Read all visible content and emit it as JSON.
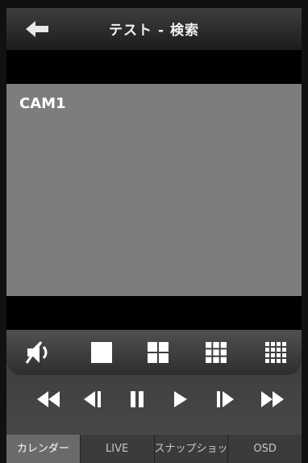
{
  "header": {
    "title": "テスト - 検索"
  },
  "video": {
    "camera_label": "CAM1"
  },
  "layout_buttons": [
    {
      "icon": "mute-speaker-icon"
    },
    {
      "icon": "layout-1-icon"
    },
    {
      "icon": "layout-4-icon"
    },
    {
      "icon": "layout-9-icon"
    },
    {
      "icon": "layout-16-icon"
    }
  ],
  "playback": [
    {
      "icon": "fast-rewind-icon"
    },
    {
      "icon": "step-back-icon"
    },
    {
      "icon": "pause-icon"
    },
    {
      "icon": "play-icon"
    },
    {
      "icon": "step-forward-icon"
    },
    {
      "icon": "fast-forward-icon"
    }
  ],
  "tabs": [
    {
      "label": "カレンダー",
      "active": true
    },
    {
      "label": "LIVE"
    },
    {
      "label": "スナップショット"
    },
    {
      "label": "OSD"
    }
  ]
}
